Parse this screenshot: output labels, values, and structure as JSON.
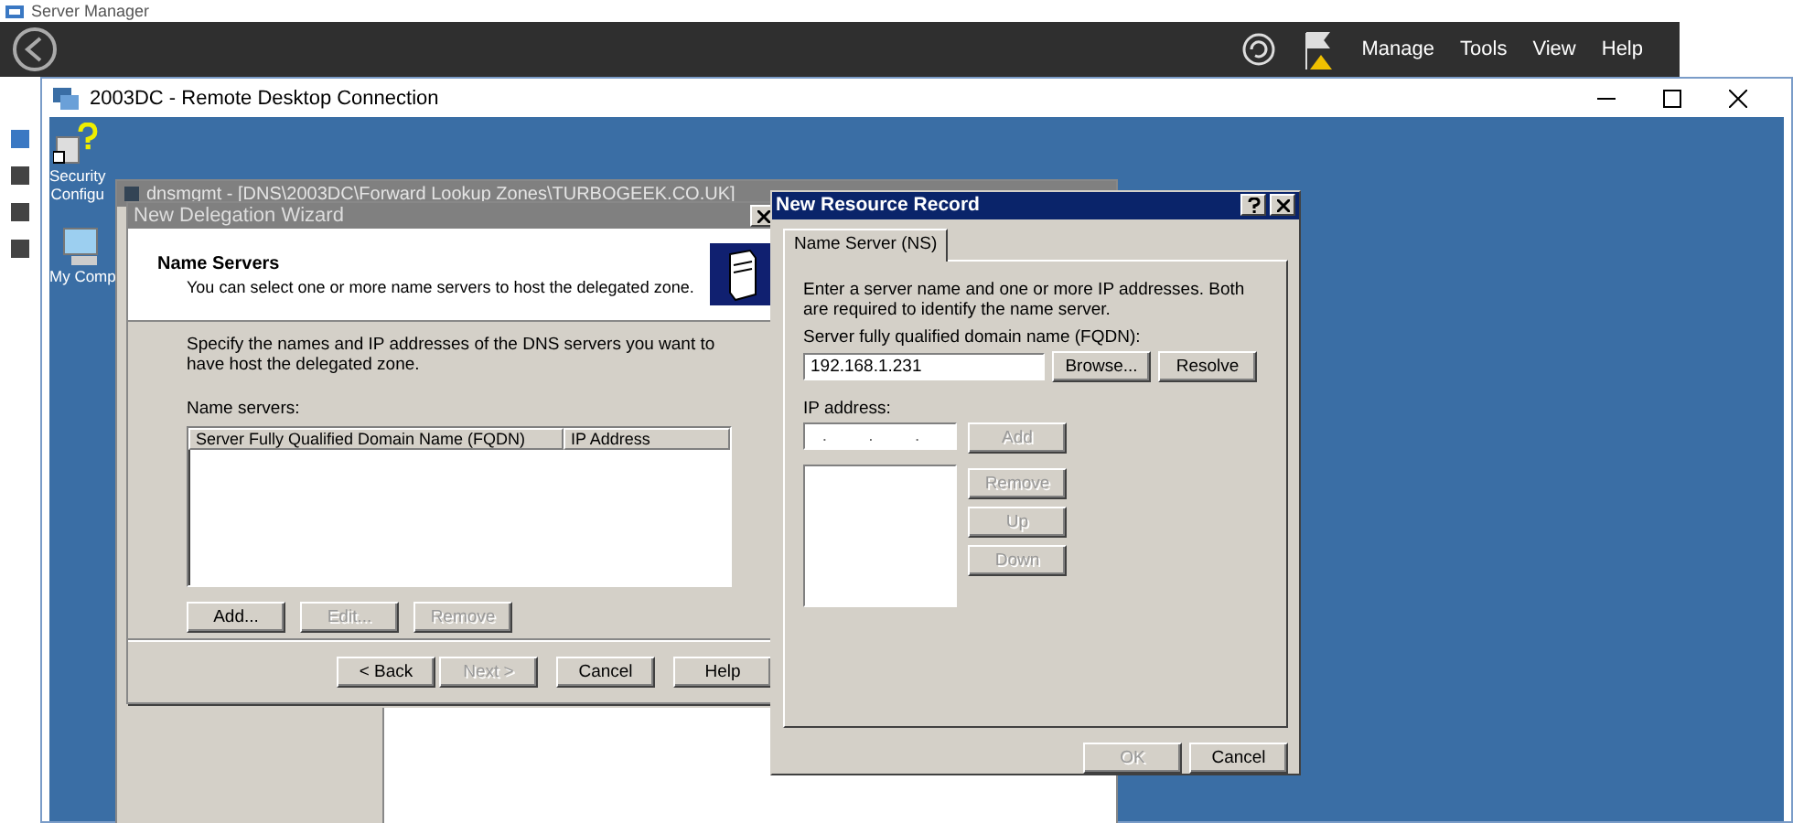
{
  "server_manager": {
    "title": "Server Manager",
    "menu": [
      "Manage",
      "Tools",
      "View",
      "Help"
    ]
  },
  "rdc": {
    "title": "2003DC - Remote Desktop Connection"
  },
  "desktop_icons": [
    {
      "kind": "security",
      "label": [
        "Security",
        "Configu"
      ]
    },
    {
      "kind": "computer",
      "label": [
        "My Comp"
      ]
    }
  ],
  "mmc": {
    "title": "dnsmgmt - [DNS\\2003DC\\Forward Lookup Zones\\TURBOGEEK.CO.UK]"
  },
  "wizard": {
    "title": "New Delegation Wizard",
    "heading": "Name Servers",
    "subheading": "You can select one or more name servers to host the delegated zone.",
    "instructions": "Specify the names and IP addresses of the DNS servers you want to have host the delegated zone.",
    "list_label": "Name servers:",
    "columns": [
      "Server Fully Qualified Domain Name (FQDN)",
      "IP Address"
    ],
    "list_buttons": [
      {
        "label": "Add...",
        "disabled": false
      },
      {
        "label": "Edit...",
        "disabled": true
      },
      {
        "label": "Remove",
        "disabled": true
      }
    ],
    "nav_buttons": [
      {
        "label": "< Back",
        "disabled": false
      },
      {
        "label": "Next >",
        "disabled": true
      },
      {
        "label": "Cancel",
        "disabled": false
      },
      {
        "label": "Help",
        "disabled": false
      }
    ]
  },
  "dialog": {
    "title": "New Resource Record",
    "tabs": [
      {
        "label": "Name Server (NS)",
        "selected": true
      }
    ],
    "description": "Enter a server name and one or more IP addresses. Both are required to identify the name server.",
    "fqdn_label": "Server fully qualified domain name (FQDN):",
    "fqdn_value": "192.168.1.231",
    "fqdn_buttons": [
      {
        "label": "Browse...",
        "disabled": false
      },
      {
        "label": "Resolve",
        "disabled": false
      }
    ],
    "ip_label": "IP address:",
    "ip_placeholder": ". . .",
    "ip_buttons": [
      {
        "label": "Add",
        "disabled": true
      },
      {
        "label": "Remove",
        "disabled": true
      },
      {
        "label": "Up",
        "disabled": true
      },
      {
        "label": "Down",
        "disabled": true
      }
    ],
    "footer_buttons": [
      {
        "label": "OK",
        "disabled": true
      },
      {
        "label": "Cancel",
        "disabled": false
      }
    ]
  }
}
